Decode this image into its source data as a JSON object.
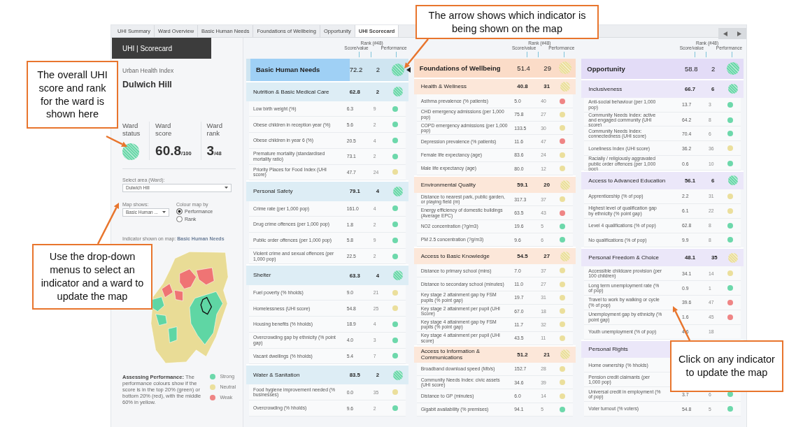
{
  "tabs": [
    {
      "label": "UHI Summary",
      "selected": false
    },
    {
      "label": "Ward Overview",
      "selected": false
    },
    {
      "label": "Basic Human Needs",
      "selected": false
    },
    {
      "label": "Foundations of Wellbeing",
      "selected": false
    },
    {
      "label": "Opportunity",
      "selected": false
    },
    {
      "label": "UHI Scorecard",
      "selected": true
    }
  ],
  "title": "UHI | Scorecard",
  "panel": {
    "index_label": "Urban Health Index",
    "ward": "Dulwich Hill",
    "stats": [
      {
        "kind": "status",
        "label": "Ward status",
        "color": "#6dd8ab"
      },
      {
        "kind": "number",
        "label": "Ward score",
        "value": "60.8",
        "suffix": "/100"
      },
      {
        "kind": "number",
        "label": "Ward rank",
        "value": "3",
        "suffix": "/48"
      }
    ],
    "select_area": {
      "label": "Select area (Ward):",
      "value": "Dulwich Hill"
    },
    "map_shows": {
      "label": "Map shows:",
      "value": "Basic Human ..."
    },
    "colour_by": {
      "label": "Colour map by",
      "options": [
        {
          "label": "Performance",
          "selected": true
        },
        {
          "label": "Rank",
          "selected": false
        }
      ]
    },
    "indicator_label": "Indicator shown on map:",
    "indicator_value": "Basic Human Needs",
    "legend": {
      "text": "**Assessing Performance:** The performance colours show if the score is in the top 20% (green) or bottom 20% (red), with the middle 60% in yellow.",
      "items": [
        {
          "label": "Strong",
          "color": "#6dd8ab"
        },
        {
          "label": "Neutral",
          "color": "#ebdf9c"
        },
        {
          "label": "Weak",
          "color": "#ef8585"
        }
      ]
    }
  },
  "columns": [
    {
      "name": "Basic Human Needs",
      "score": "72.2",
      "rank": "2",
      "color": "#6dd8ab",
      "on_map": true,
      "headers": {
        "rank": "Rank (#48)",
        "score": "Score/value",
        "performance": "Performance"
      },
      "components": [
        {
          "name": "Nutrition & Basic Medical Care",
          "score": "62.8",
          "rank": "2",
          "color": "#6dd8ab",
          "indicators": [
            {
              "name": "Low birth weight (%)",
              "score": "6.3",
              "rank": "9",
              "color": "#6dd8ab"
            },
            {
              "name": "Obese children in reception year (%)",
              "score": "5.6",
              "rank": "2",
              "color": "#6dd8ab"
            },
            {
              "name": "Obese children in year 6 (%)",
              "score": "20.5",
              "rank": "4",
              "color": "#6dd8ab"
            },
            {
              "name": "Premature mortality (standardised mortality ratio)",
              "score": "73.1",
              "rank": "2",
              "color": "#6dd8ab"
            },
            {
              "name": "Priority Places for Food Index (UHI score)",
              "score": "47.7",
              "rank": "24",
              "color": "#ebdf9c"
            }
          ]
        },
        {
          "name": "Personal Safety",
          "score": "79.1",
          "rank": "4",
          "color": "#6dd8ab",
          "indicators": [
            {
              "name": "Crime rate (per 1,000 pop)",
              "score": "161.0",
              "rank": "4",
              "color": "#6dd8ab"
            },
            {
              "name": "Drug crime offences (per 1,000 pop)",
              "score": "1.8",
              "rank": "2",
              "color": "#6dd8ab"
            },
            {
              "name": "Public order offences (per 1,000 pop)",
              "score": "5.8",
              "rank": "9",
              "color": "#6dd8ab"
            },
            {
              "name": "Violent crime and sexual offences (per 1,000 pop)",
              "score": "22.5",
              "rank": "2",
              "color": "#6dd8ab"
            }
          ]
        },
        {
          "name": "Shelter",
          "score": "63.3",
          "rank": "4",
          "color": "#6dd8ab",
          "indicators": [
            {
              "name": "Fuel poverty (% hholds)",
              "score": "9.0",
              "rank": "21",
              "color": "#ebdf9c"
            },
            {
              "name": "Homelessness (UHI score)",
              "score": "54.8",
              "rank": "25",
              "color": "#ebdf9c"
            },
            {
              "name": "Housing benefits (% hholds)",
              "score": "18.9",
              "rank": "4",
              "color": "#6dd8ab"
            },
            {
              "name": "Overcrowding gap by ethnicity (% point gap)",
              "score": "4.0",
              "rank": "3",
              "color": "#6dd8ab"
            },
            {
              "name": "Vacant dwellings (% hholds)",
              "score": "5.4",
              "rank": "7",
              "color": "#6dd8ab"
            }
          ]
        },
        {
          "name": "Water & Sanitation",
          "score": "83.5",
          "rank": "2",
          "color": "#6dd8ab",
          "indicators": [
            {
              "name": "Food hygiene improvement needed (% businesses)",
              "score": "0.0",
              "rank": "35",
              "color": "#ebdf9c"
            },
            {
              "name": "Overcrowding (% hholds)",
              "score": "9.6",
              "rank": "2",
              "color": "#6dd8ab"
            }
          ]
        }
      ]
    },
    {
      "name": "Foundations of Wellbeing",
      "score": "51.4",
      "rank": "29",
      "color": "#ebdf9c",
      "on_map": false,
      "headers": {
        "rank": "Rank (#48)",
        "score": "Score/value",
        "performance": "Performance"
      },
      "components": [
        {
          "name": "Health & Wellness",
          "score": "40.8",
          "rank": "31",
          "color": "#ebdf9c",
          "indicators": [
            {
              "name": "Asthma prevalence (% patients)",
              "score": "5.0",
              "rank": "40",
              "color": "#ef8585"
            },
            {
              "name": "CHD emergency admissions (per 1,000 pop)",
              "score": "75.8",
              "rank": "27",
              "color": "#ebdf9c"
            },
            {
              "name": "COPD emergency admissions (per 1,000 pop)",
              "score": "133.5",
              "rank": "30",
              "color": "#ebdf9c"
            },
            {
              "name": "Depression prevalence (% patients)",
              "score": "11.6",
              "rank": "47",
              "color": "#ef8585"
            },
            {
              "name": "Female life expectancy (age)",
              "score": "83.6",
              "rank": "24",
              "color": "#ebdf9c"
            },
            {
              "name": "Male life expectancy (age)",
              "score": "80.0",
              "rank": "12",
              "color": "#ebdf9c"
            }
          ]
        },
        {
          "name": "Environmental Quality",
          "score": "59.1",
          "rank": "20",
          "color": "#ebdf9c",
          "indicators": [
            {
              "name": "Distance to nearest park, public garden, or playing field (m)",
              "score": "317.3",
              "rank": "37",
              "color": "#ebdf9c"
            },
            {
              "name": "Energy efficiency of domestic buildings (Average EPC)",
              "score": "63.5",
              "rank": "43",
              "color": "#ef8585"
            },
            {
              "name": "NO2 concentration (?g/m3)",
              "score": "19.6",
              "rank": "5",
              "color": "#6dd8ab"
            },
            {
              "name": "PM 2.5 concentration (?g/m3)",
              "score": "9.6",
              "rank": "6",
              "color": "#6dd8ab"
            }
          ]
        },
        {
          "name": "Access to Basic Knowledge",
          "score": "54.5",
          "rank": "27",
          "color": "#ebdf9c",
          "indicators": [
            {
              "name": "Distance to primary school (mins)",
              "score": "7.0",
              "rank": "37",
              "color": "#ebdf9c"
            },
            {
              "name": "Distance to secondary school (minutes)",
              "score": "11.0",
              "rank": "27",
              "color": "#ebdf9c"
            },
            {
              "name": "Key stage 2 attainment gap by FSM pupils (% point gap)",
              "score": "19.7",
              "rank": "31",
              "color": "#ebdf9c"
            },
            {
              "name": "Key stage 2 attainment per pupil (UHI Score)",
              "score": "67.0",
              "rank": "18",
              "color": "#ebdf9c"
            },
            {
              "name": "Key stage 4 attainment gap by FSM pupils (% point gap)",
              "score": "11.7",
              "rank": "32",
              "color": "#ebdf9c"
            },
            {
              "name": "Key stage 4 attainment per pupil (UHI score)",
              "score": "43.5",
              "rank": "11",
              "color": "#ebdf9c"
            }
          ]
        },
        {
          "name": "Access to Information & Communications",
          "score": "51.2",
          "rank": "21",
          "color": "#ebdf9c",
          "indicators": [
            {
              "name": "Broadband download speed (Mb/s)",
              "score": "152.7",
              "rank": "28",
              "color": "#ebdf9c"
            },
            {
              "name": "Community Needs Index: civic assets (UHI score)",
              "score": "34.6",
              "rank": "39",
              "color": "#ebdf9c"
            },
            {
              "name": "Distance to GP (minutes)",
              "score": "6.0",
              "rank": "14",
              "color": "#ebdf9c"
            },
            {
              "name": "Gigabit availability (% premises)",
              "score": "94.1",
              "rank": "5",
              "color": "#6dd8ab"
            }
          ]
        }
      ]
    },
    {
      "name": "Opportunity",
      "score": "58.8",
      "rank": "2",
      "color": "#6dd8ab",
      "on_map": false,
      "headers": {
        "rank": "Rank (#48)",
        "score": "Score/value",
        "performance": "Performance"
      },
      "components": [
        {
          "name": "Inclusiveness",
          "score": "66.7",
          "rank": "6",
          "color": "#6dd8ab",
          "indicators": [
            {
              "name": "Anti-social behaviour (per 1,000 pop)",
              "score": "13.7",
              "rank": "3",
              "color": "#6dd8ab"
            },
            {
              "name": "Community Needs Index: active and engaged community (UHI score)",
              "score": "64.2",
              "rank": "8",
              "color": "#6dd8ab"
            },
            {
              "name": "Community Needs Index: connectedness (UHI score)",
              "score": "70.4",
              "rank": "6",
              "color": "#6dd8ab"
            },
            {
              "name": "Loneliness Index (UHI score)",
              "score": "36.2",
              "rank": "36",
              "color": "#ebdf9c"
            },
            {
              "name": "Racially / religiously aggravated public order offences (per 1,000 pop)",
              "score": "0.6",
              "rank": "10",
              "color": "#6dd8ab"
            }
          ]
        },
        {
          "name": "Access to Advanced Education",
          "score": "56.1",
          "rank": "6",
          "color": "#6dd8ab",
          "indicators": [
            {
              "name": "Apprenticeship (% of pop)",
              "score": "2.2",
              "rank": "31",
              "color": "#ebdf9c"
            },
            {
              "name": "Highest level of qualification gap by ethnicity (% point gap)",
              "score": "6.1",
              "rank": "22",
              "color": "#ebdf9c"
            },
            {
              "name": "Level 4 qualifications (% of pop)",
              "score": "62.8",
              "rank": "8",
              "color": "#6dd8ab"
            },
            {
              "name": "No qualifications (% of pop)",
              "score": "9.9",
              "rank": "8",
              "color": "#6dd8ab"
            }
          ]
        },
        {
          "name": "Personal Freedom & Choice",
          "score": "48.1",
          "rank": "35",
          "color": "#ebdf9c",
          "indicators": [
            {
              "name": "Accessible childcare provision (per 100 children)",
              "score": "34.1",
              "rank": "14",
              "color": "#ebdf9c"
            },
            {
              "name": "Long term unemployment rate (% of pop)",
              "score": "0.9",
              "rank": "1",
              "color": "#6dd8ab"
            },
            {
              "name": "Travel to work by walking or cycle (% of pop)",
              "score": "39.6",
              "rank": "47",
              "color": "#ef8585"
            },
            {
              "name": "Unemployment gap by ethnicity (% point gap)",
              "score": "1.6",
              "rank": "45",
              "color": "#ef8585"
            },
            {
              "name": "Youth unemployment (% of pop)",
              "score": "4.6",
              "rank": "18"
            }
          ]
        },
        {
          "name": "Personal Rights",
          "indicators": [
            {
              "name": "Home ownership (% hholds)"
            },
            {
              "name": "Pension credit claimants (per 1,000 pop)"
            },
            {
              "name": "Universal credit in employment (% of pop)",
              "score": "3.7",
              "rank": "6",
              "color": "#6dd8ab"
            },
            {
              "name": "Voter turnout (% voters)",
              "score": "54.8",
              "rank": "5",
              "color": "#6dd8ab"
            }
          ]
        }
      ]
    }
  ],
  "callouts": [
    {
      "text": "The overall UHI score and rank for the ward is shown here"
    },
    {
      "text": "Use the drop-down menus to select an indicator and a ward to update the map"
    },
    {
      "text": "The arrow shows which indicator is being shown on the map"
    },
    {
      "text": "Click on any indicator to update the map"
    }
  ]
}
